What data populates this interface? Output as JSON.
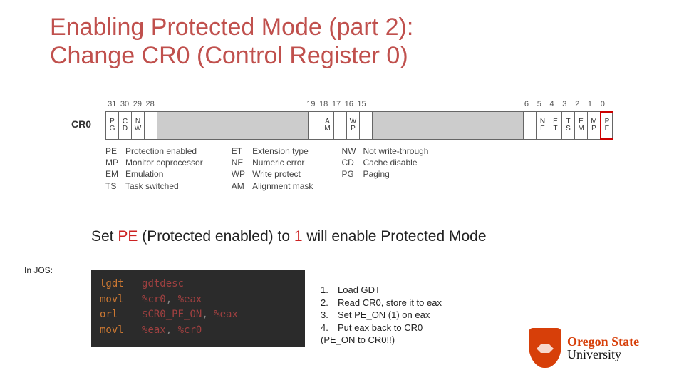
{
  "title_line1": "Enabling Protected Mode (part 2):",
  "title_line2": "Change CR0 (Control Register 0)",
  "cr0": {
    "label": "CR0",
    "bitnums": {
      "b31": "31",
      "b30": "30",
      "b29": "29",
      "b28": "28",
      "b19": "19",
      "b18": "18",
      "b17": "17",
      "b16": "16",
      "b15": "15",
      "b6": "6",
      "b5": "5",
      "b4": "4",
      "b3": "3",
      "b2": "2",
      "b1": "1",
      "b0": "0"
    },
    "cells": {
      "c31a": "P",
      "c31b": "G",
      "c30a": "C",
      "c30b": "D",
      "c29a": "N",
      "c29b": "W",
      "c18a": "A",
      "c18b": "M",
      "c16a": "W",
      "c16b": "P",
      "c5a": "N",
      "c5b": "E",
      "c4a": "E",
      "c4b": "T",
      "c3a": "T",
      "c3b": "S",
      "c2a": "E",
      "c2b": "M",
      "c1a": "M",
      "c1b": "P",
      "c0a": "P",
      "c0b": "E"
    }
  },
  "legend": {
    "col1": {
      "k0": "PE",
      "d0": "Protection enabled",
      "k1": "MP",
      "d1": "Monitor coprocessor",
      "k2": "EM",
      "d2": "Emulation",
      "k3": "TS",
      "d3": "Task switched"
    },
    "col2": {
      "k0": "ET",
      "d0": "Extension type",
      "k1": "NE",
      "d1": "Numeric error",
      "k2": "WP",
      "d2": "Write protect",
      "k3": "AM",
      "d3": "Alignment mask"
    },
    "col3": {
      "k0": "NW",
      "d0": "Not write-through",
      "k1": "CD",
      "d1": "Cache disable",
      "k2": "PG",
      "d2": "Paging"
    }
  },
  "subtitle_pre": "Set ",
  "subtitle_pe": "PE",
  "subtitle_mid": " (Protected enabled) to ",
  "subtitle_one": "1",
  "subtitle_post": " will enable Protected Mode",
  "injos_label": "In JOS:",
  "code": {
    "l1_mn": "lgdt",
    "l1_arg": "gdtdesc",
    "l2_mn": "movl",
    "l2_a": "%cr0",
    "l2_sep": ", ",
    "l2_b": "%eax",
    "l3_mn": "orl",
    "l3_a": "$CR0_PE_ON",
    "l3_sep": ", ",
    "l3_b": "%eax",
    "l4_mn": "movl",
    "l4_a": "%eax",
    "l4_sep": ", ",
    "l4_b": "%cr0"
  },
  "steps": {
    "n1": "1.",
    "t1": "Load GDT",
    "n2": "2.",
    "t2": "Read CR0, store it to eax",
    "n3": "3.",
    "t3": "Set PE_ON (1) on eax",
    "n4": "4.",
    "t4": "Put eax back to CR0",
    "tail": "(PE_ON to CR0!!)"
  },
  "logo": {
    "line1": "Oregon State",
    "line2": "University"
  }
}
